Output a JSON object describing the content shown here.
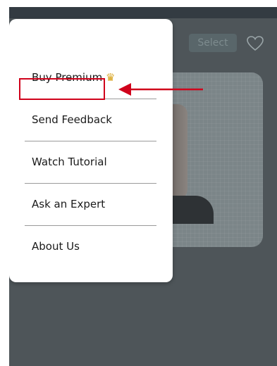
{
  "header": {
    "select_label": "Select"
  },
  "menu": {
    "items": [
      {
        "label": "Buy Premium",
        "badge_icon": "crown-icon"
      },
      {
        "label": "Send Feedback"
      },
      {
        "label": "Watch Tutorial"
      },
      {
        "label": "Ask an Expert"
      },
      {
        "label": "About Us"
      }
    ]
  },
  "annotation": {
    "highlight_color": "#d0021b",
    "target": "Send Feedback"
  },
  "colors": {
    "backdrop": "#4e5559",
    "menu_bg": "#ffffff",
    "text": "#1a1a1a"
  }
}
